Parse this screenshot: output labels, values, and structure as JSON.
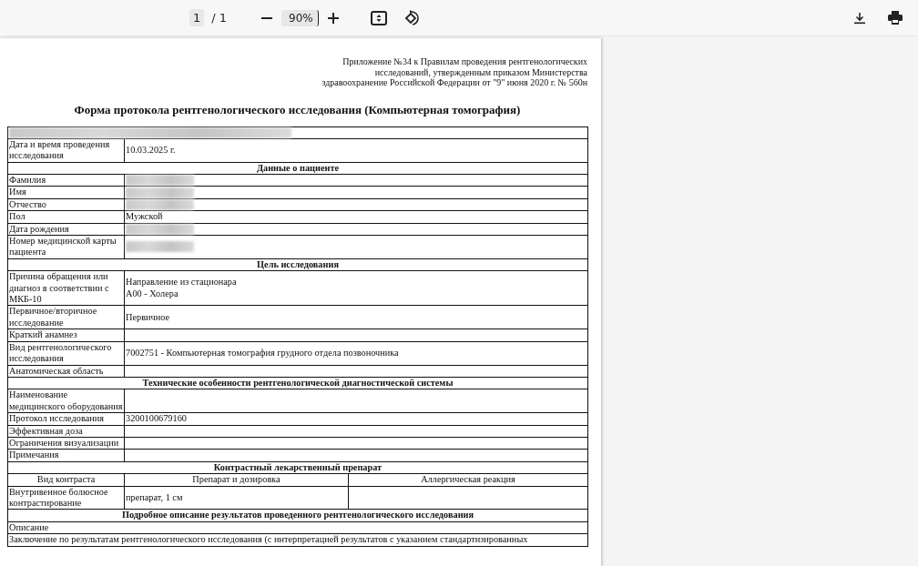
{
  "toolbar": {
    "page_number": "1",
    "page_count": "/ 1",
    "zoom": "90%"
  },
  "document": {
    "appendix_lines": [
      "Приложение №34 к Правилам проведения рентгенологических",
      "исследований, утвержденным приказом Министерства",
      "здравоохранение Российской Федерации от \"9\" июня 2020 г. № 560н"
    ],
    "title": "Форма протокола рентгенологического исследования (Компьютерная томография)",
    "rows": [
      {
        "kind": "redacted"
      },
      {
        "kind": "field",
        "label": "Дата и время проведения исследования",
        "value": "10.03.2025 г."
      },
      {
        "kind": "section",
        "title": "Данные о пациенте"
      },
      {
        "kind": "field",
        "label": "Фамилия",
        "redacted": true
      },
      {
        "kind": "field",
        "label": "Имя",
        "redacted": true
      },
      {
        "kind": "field",
        "label": "Отчество",
        "redacted": true
      },
      {
        "kind": "field",
        "label": "Пол",
        "value": "Мужской"
      },
      {
        "kind": "field",
        "label": "Дата рождения",
        "redacted": true
      },
      {
        "kind": "field",
        "label": "Номер медицинской карты пациента",
        "redacted": true
      },
      {
        "kind": "section",
        "title": "Цель исследования"
      },
      {
        "kind": "field",
        "label": "Причина обращения или диагноз в соответствии с МКБ-10",
        "value_lines": [
          "Направление из стационара",
          "А00 - Холера"
        ]
      },
      {
        "kind": "field",
        "label": "Первичное/вторичное исследование",
        "value": "Первичное"
      },
      {
        "kind": "field",
        "label": "Краткий анамнез"
      },
      {
        "kind": "field",
        "label": "Вид рентгенологического исследования",
        "value": "7002751 - Компьютерная томография грудного отдела позвоночника"
      },
      {
        "kind": "field",
        "label": "Анатомическая область"
      },
      {
        "kind": "section",
        "title": "Технические особенности рентгенологической диагностической системы"
      },
      {
        "kind": "field",
        "label": "Наименование медицинского оборудования"
      },
      {
        "kind": "field",
        "label": "Протокол исследования",
        "value": "3200100679160"
      },
      {
        "kind": "field",
        "label": "Эффективная доза"
      },
      {
        "kind": "field",
        "label": "Ограничения визуализации"
      },
      {
        "kind": "field",
        "label": "Примечания"
      },
      {
        "kind": "section",
        "title": "Контрастный лекарственный препарат"
      },
      {
        "kind": "header3",
        "cells": [
          "Вид контраста",
          "Препарат и дозировка",
          "Аллергическая реакция"
        ]
      },
      {
        "kind": "row3",
        "cells": [
          "Внутривенное болюсное контрастирование",
          "препарат, 1 см",
          ""
        ]
      },
      {
        "kind": "section",
        "title": "Подробное описание результатов проведенного рентгенологического исследования"
      },
      {
        "kind": "wide",
        "text": "Описание"
      },
      {
        "kind": "wide",
        "text": "Заключение по результатам рентгенологического исследования (с интерпретацией результатов с указанием стандартизированных"
      }
    ]
  }
}
